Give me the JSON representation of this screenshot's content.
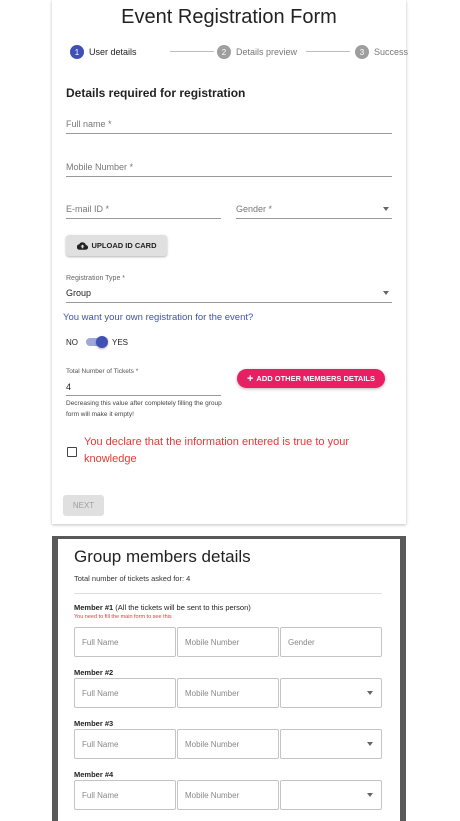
{
  "form": {
    "title": "Event Registration Form",
    "steps": [
      {
        "num": "1",
        "label": "User details",
        "active": true
      },
      {
        "num": "2",
        "label": "Details preview",
        "active": false
      },
      {
        "num": "3",
        "label": "Success",
        "active": false
      }
    ],
    "section_title": "Details required for registration",
    "full_name_placeholder": "Full name *",
    "mobile_placeholder": "Mobile Number *",
    "email_placeholder": "E-mail ID *",
    "gender_placeholder": "Gender *",
    "upload_label": "UPLOAD ID CARD",
    "registration_type_label": "Registration Type *",
    "registration_type_value": "Group",
    "own_registration_question": "You want your own registration for the event?",
    "toggle_no": "NO",
    "toggle_yes": "YES",
    "toggle_checked": true,
    "tickets_label": "Total Number of Tickets *",
    "tickets_value": "4",
    "tickets_helper": "Decreasing this value after completely filling the group form will make it empty!",
    "add_members_label": "ADD OTHER MEMBERS DETAILS",
    "declaration": "You declare that the information entered is true to your knowledge",
    "declaration_checked": false,
    "next_label": "NEXT"
  },
  "group": {
    "title": "Group members details",
    "subtitle": "Total number of tickets asked for: 4",
    "member1_label": "Member #1",
    "member1_note": "(All the tickets will be sent to this person)",
    "member1_warning": "You need to fill the main form to see this",
    "member_labels": [
      "Member #2",
      "Member #3",
      "Member #4"
    ],
    "full_name_placeholder": "Full Name",
    "mobile_placeholder": "Mobile Number",
    "gender_placeholder": "Gender"
  },
  "colors": {
    "primary": "#3f51b5",
    "accent": "#e91e63",
    "error": "#e53935",
    "inactive_step": "#9e9e9e"
  }
}
